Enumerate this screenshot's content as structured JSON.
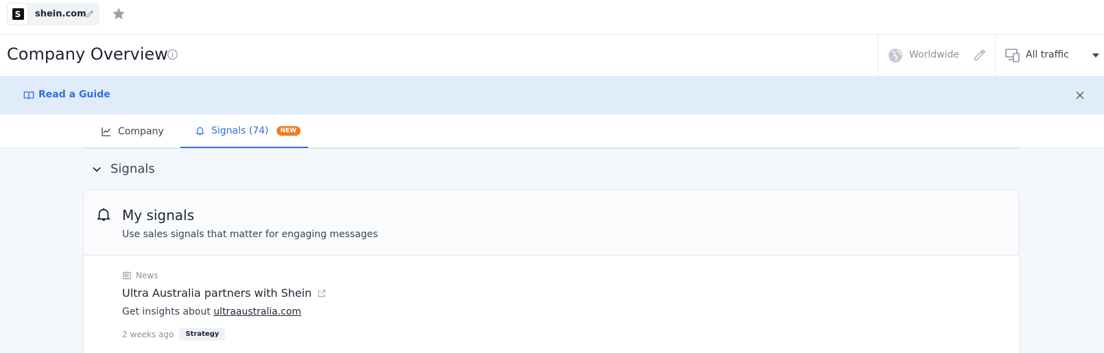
{
  "topbar": {
    "favicon_letter": "S",
    "domain": "shein.com"
  },
  "header": {
    "title": "Company Overview",
    "geo_label": "Worldwide",
    "traffic_label": "All traffic"
  },
  "guide": {
    "link_label": "Read a Guide"
  },
  "tabs": [
    {
      "label": "Company"
    },
    {
      "label": "Signals (74)",
      "badge": "NEW"
    }
  ],
  "section": {
    "title": "Signals"
  },
  "card": {
    "title": "My signals",
    "subtitle": "Use sales signals that matter for engaging messages",
    "signal": {
      "source": "News",
      "headline": "Ultra Australia partners with Shein",
      "insights_prefix": "Get insights about ",
      "insights_domain": "ultraaustralia.com",
      "time": "2 weeks ago",
      "tag": "Strategy"
    }
  },
  "colors": {
    "accent": "#2f6fe0",
    "badge": "#f57c1f",
    "banner": "#e1ecfb"
  },
  "icons": [
    "pencil-icon",
    "star-icon",
    "info-icon",
    "globe-icon",
    "devices-icon",
    "book-icon",
    "close-icon",
    "chart-line-icon",
    "bell-icon",
    "chevron-down-icon",
    "newspaper-icon",
    "external-link-icon"
  ]
}
